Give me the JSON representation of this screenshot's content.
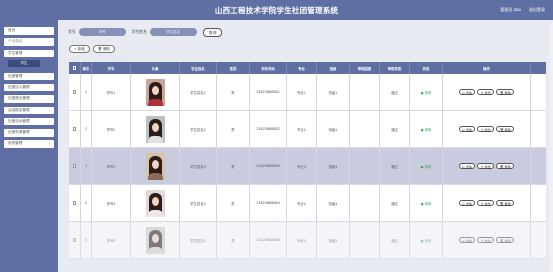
{
  "header": {
    "title": "山西工程技术学院学生社团管理系统",
    "user": "管理员 abo",
    "logout": "退出登录"
  },
  "sidebar": {
    "items": [
      {
        "label": "首页"
      },
      {
        "label": "个人中心"
      },
      {
        "label": "学生管理",
        "sub": "学生"
      },
      {
        "label": "社团管理"
      },
      {
        "label": "社团加入管理"
      },
      {
        "label": "社团退出管理"
      },
      {
        "label": "活动报名管理"
      },
      {
        "label": "社团活动管理"
      },
      {
        "label": "社团申请管理"
      },
      {
        "label": "系统管理"
      }
    ]
  },
  "search": {
    "field1_label": "学号",
    "field1_placeholder": "学号",
    "field2_label": "学生姓名",
    "field2_placeholder": "学生姓名",
    "button": "查询"
  },
  "actions": {
    "add": "+ 新增",
    "delete": "🗑 删除"
  },
  "table": {
    "headers": [
      "",
      "索引",
      "学号",
      "头像",
      "学生姓名",
      "性别",
      "手机号码",
      "专业",
      "班级",
      "审核回复",
      "审核状态",
      "状态",
      "操作"
    ],
    "rows": [
      {
        "index": "1",
        "id": "学号1",
        "name": "学生姓名1",
        "sex": "男",
        "phone": "13823888881",
        "major": "专业1",
        "class": "班级1",
        "reason": "",
        "audit": "通过",
        "status": "● 审核",
        "photo": {
          "bg": "#c8a79a",
          "body": "#b0303a"
        }
      },
      {
        "index": "2",
        "id": "学号2",
        "name": "学生姓名2",
        "sex": "男",
        "phone": "13823888882",
        "major": "专业2",
        "class": "班级2",
        "reason": "",
        "audit": "通过",
        "status": "● 审核",
        "photo": {
          "bg": "#b7c3c4",
          "body": "#e0e0e0"
        }
      },
      {
        "index": "3",
        "id": "学号3",
        "name": "学生姓名3",
        "sex": "男",
        "phone": "13823888883",
        "major": "专业3",
        "class": "班级3",
        "reason": "",
        "audit": "通过",
        "status": "● 审核",
        "photo": {
          "bg": "#d9c2a8",
          "body": "#8a6b5a"
        }
      },
      {
        "index": "4",
        "id": "学号4",
        "name": "学生姓名4",
        "sex": "男",
        "phone": "13823888884",
        "major": "专业4",
        "class": "班级4",
        "reason": "",
        "audit": "通过",
        "status": "● 审核",
        "photo": {
          "bg": "#e4d8d8",
          "body": "#f0e6e6"
        }
      },
      {
        "index": "5",
        "id": "学号5",
        "name": "学生姓名5",
        "sex": "男",
        "phone": "13823888885",
        "major": "专业5",
        "class": "班级5",
        "reason": "",
        "audit": "通过",
        "status": "● 审核",
        "photo": {
          "bg": "#c9d2c6",
          "body": "#d8d0c8"
        }
      }
    ],
    "row_ops": {
      "detail": "详情",
      "edit": "修改",
      "delete": "删除"
    }
  },
  "colors": {
    "primary": "#5f6fa3",
    "highlight_row": "#c9ccdf",
    "status_green": "#3aa85b"
  }
}
